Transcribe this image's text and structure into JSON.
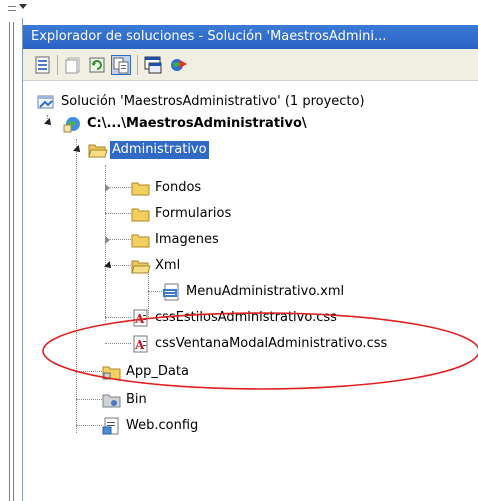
{
  "panel": {
    "title": "Explorador de soluciones - Solución 'MaestrosAdmini... "
  },
  "toolbar": {
    "buttons": [
      {
        "icon": "properties-icon"
      },
      {
        "icon": "show-all-files-icon"
      },
      {
        "icon": "refresh-icon"
      },
      {
        "icon": "nest-related-files-icon"
      },
      {
        "icon": "view-designer-icon"
      },
      {
        "icon": "copy-website-icon"
      }
    ]
  },
  "tree": {
    "solution": "Solución 'MaestrosAdministrativo' (1 proyecto)",
    "project": "C:\\...\\MaestrosAdministrativo\\",
    "folder_admin": "Administrativo",
    "folder_fondos": "Fondos",
    "folder_formularios": "Formularios",
    "folder_imagenes": "Imagenes",
    "folder_xml": "Xml",
    "file_menu": "MenuAdministrativo.xml",
    "file_css1": "cssEstilosAdministrativo.css",
    "file_css2": "cssVentanaModalAdministrativo.css",
    "folder_appdata": "App_Data",
    "folder_bin": "Bin",
    "file_webconfig": "Web.config"
  },
  "annotation_color": "#e02020",
  "selection_color": "#316ac5"
}
